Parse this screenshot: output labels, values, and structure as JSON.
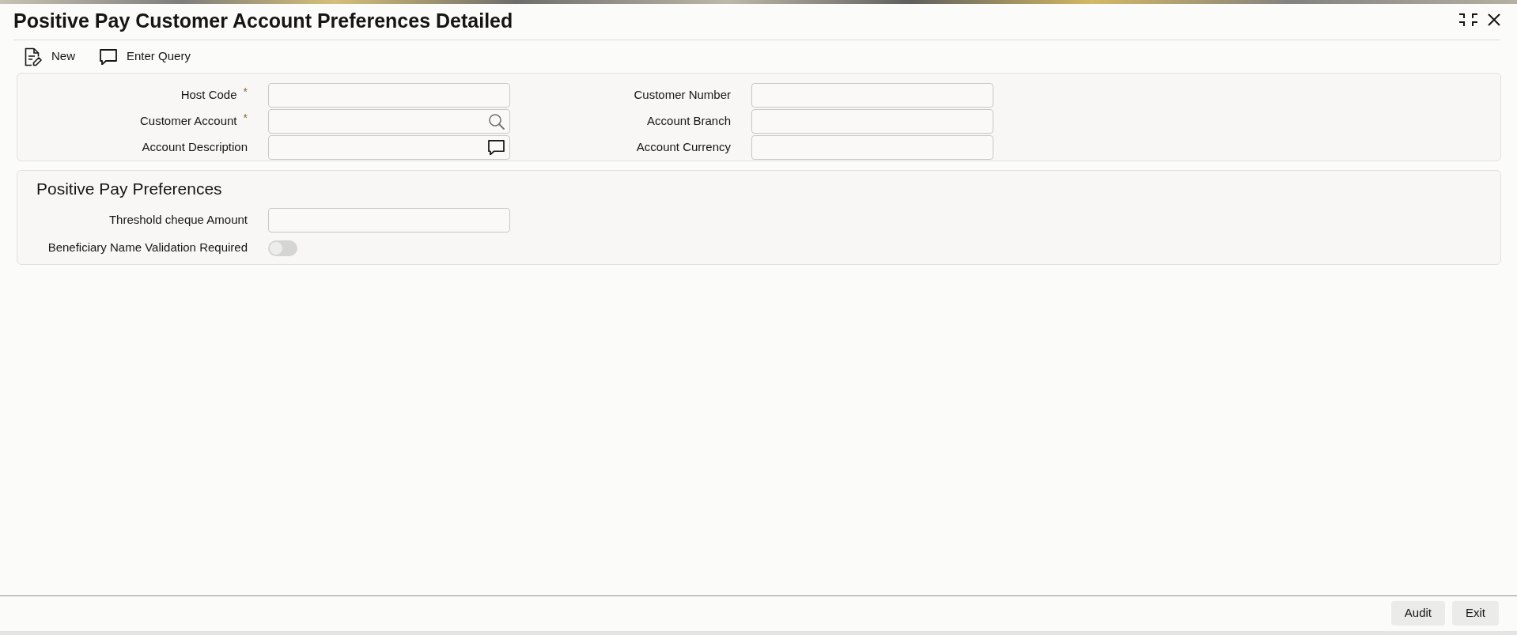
{
  "window": {
    "title": "Positive Pay Customer Account Preferences Detailed"
  },
  "toolbar": [
    {
      "kind": "new",
      "label": "New"
    },
    {
      "kind": "query",
      "label": "Enter Query"
    }
  ],
  "account_panel": {
    "columns": [
      {
        "fields": [
          {
            "kind": "text",
            "label": "Host Code",
            "required_mark": "*"
          },
          {
            "kind": "lookup",
            "label": "Customer Account",
            "required_mark": "*"
          },
          {
            "kind": "comment",
            "label": "Account Description"
          }
        ]
      },
      {
        "fields": [
          {
            "kind": "text",
            "label": "Customer Number"
          },
          {
            "kind": "text",
            "label": "Account Branch"
          },
          {
            "kind": "text",
            "label": "Account Currency"
          }
        ]
      }
    ]
  },
  "preferences_panel": {
    "title": "Positive Pay Preferences",
    "fields": [
      {
        "kind": "text",
        "label": "Threshold cheque Amount"
      },
      {
        "kind": "toggle",
        "label": "Beneficiary Name Validation Required",
        "on": false
      }
    ]
  },
  "footer": {
    "buttons": [
      "Audit",
      "Exit"
    ]
  }
}
